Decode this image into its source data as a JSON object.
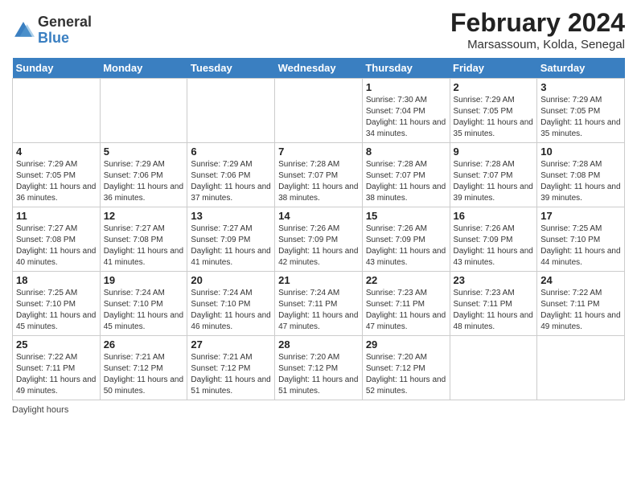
{
  "header": {
    "logo_general": "General",
    "logo_blue": "Blue",
    "month_year": "February 2024",
    "location": "Marsassoum, Kolda, Senegal"
  },
  "days_of_week": [
    "Sunday",
    "Monday",
    "Tuesday",
    "Wednesday",
    "Thursday",
    "Friday",
    "Saturday"
  ],
  "weeks": [
    [
      {
        "day": "",
        "info": ""
      },
      {
        "day": "",
        "info": ""
      },
      {
        "day": "",
        "info": ""
      },
      {
        "day": "",
        "info": ""
      },
      {
        "day": "1",
        "info": "Sunrise: 7:30 AM\nSunset: 7:04 PM\nDaylight: 11 hours and 34 minutes."
      },
      {
        "day": "2",
        "info": "Sunrise: 7:29 AM\nSunset: 7:05 PM\nDaylight: 11 hours and 35 minutes."
      },
      {
        "day": "3",
        "info": "Sunrise: 7:29 AM\nSunset: 7:05 PM\nDaylight: 11 hours and 35 minutes."
      }
    ],
    [
      {
        "day": "4",
        "info": "Sunrise: 7:29 AM\nSunset: 7:05 PM\nDaylight: 11 hours and 36 minutes."
      },
      {
        "day": "5",
        "info": "Sunrise: 7:29 AM\nSunset: 7:06 PM\nDaylight: 11 hours and 36 minutes."
      },
      {
        "day": "6",
        "info": "Sunrise: 7:29 AM\nSunset: 7:06 PM\nDaylight: 11 hours and 37 minutes."
      },
      {
        "day": "7",
        "info": "Sunrise: 7:28 AM\nSunset: 7:07 PM\nDaylight: 11 hours and 38 minutes."
      },
      {
        "day": "8",
        "info": "Sunrise: 7:28 AM\nSunset: 7:07 PM\nDaylight: 11 hours and 38 minutes."
      },
      {
        "day": "9",
        "info": "Sunrise: 7:28 AM\nSunset: 7:07 PM\nDaylight: 11 hours and 39 minutes."
      },
      {
        "day": "10",
        "info": "Sunrise: 7:28 AM\nSunset: 7:08 PM\nDaylight: 11 hours and 39 minutes."
      }
    ],
    [
      {
        "day": "11",
        "info": "Sunrise: 7:27 AM\nSunset: 7:08 PM\nDaylight: 11 hours and 40 minutes."
      },
      {
        "day": "12",
        "info": "Sunrise: 7:27 AM\nSunset: 7:08 PM\nDaylight: 11 hours and 41 minutes."
      },
      {
        "day": "13",
        "info": "Sunrise: 7:27 AM\nSunset: 7:09 PM\nDaylight: 11 hours and 41 minutes."
      },
      {
        "day": "14",
        "info": "Sunrise: 7:26 AM\nSunset: 7:09 PM\nDaylight: 11 hours and 42 minutes."
      },
      {
        "day": "15",
        "info": "Sunrise: 7:26 AM\nSunset: 7:09 PM\nDaylight: 11 hours and 43 minutes."
      },
      {
        "day": "16",
        "info": "Sunrise: 7:26 AM\nSunset: 7:09 PM\nDaylight: 11 hours and 43 minutes."
      },
      {
        "day": "17",
        "info": "Sunrise: 7:25 AM\nSunset: 7:10 PM\nDaylight: 11 hours and 44 minutes."
      }
    ],
    [
      {
        "day": "18",
        "info": "Sunrise: 7:25 AM\nSunset: 7:10 PM\nDaylight: 11 hours and 45 minutes."
      },
      {
        "day": "19",
        "info": "Sunrise: 7:24 AM\nSunset: 7:10 PM\nDaylight: 11 hours and 45 minutes."
      },
      {
        "day": "20",
        "info": "Sunrise: 7:24 AM\nSunset: 7:10 PM\nDaylight: 11 hours and 46 minutes."
      },
      {
        "day": "21",
        "info": "Sunrise: 7:24 AM\nSunset: 7:11 PM\nDaylight: 11 hours and 47 minutes."
      },
      {
        "day": "22",
        "info": "Sunrise: 7:23 AM\nSunset: 7:11 PM\nDaylight: 11 hours and 47 minutes."
      },
      {
        "day": "23",
        "info": "Sunrise: 7:23 AM\nSunset: 7:11 PM\nDaylight: 11 hours and 48 minutes."
      },
      {
        "day": "24",
        "info": "Sunrise: 7:22 AM\nSunset: 7:11 PM\nDaylight: 11 hours and 49 minutes."
      }
    ],
    [
      {
        "day": "25",
        "info": "Sunrise: 7:22 AM\nSunset: 7:11 PM\nDaylight: 11 hours and 49 minutes."
      },
      {
        "day": "26",
        "info": "Sunrise: 7:21 AM\nSunset: 7:12 PM\nDaylight: 11 hours and 50 minutes."
      },
      {
        "day": "27",
        "info": "Sunrise: 7:21 AM\nSunset: 7:12 PM\nDaylight: 11 hours and 51 minutes."
      },
      {
        "day": "28",
        "info": "Sunrise: 7:20 AM\nSunset: 7:12 PM\nDaylight: 11 hours and 51 minutes."
      },
      {
        "day": "29",
        "info": "Sunrise: 7:20 AM\nSunset: 7:12 PM\nDaylight: 11 hours and 52 minutes."
      },
      {
        "day": "",
        "info": ""
      },
      {
        "day": "",
        "info": ""
      }
    ]
  ],
  "footer": {
    "daylight_label": "Daylight hours"
  }
}
